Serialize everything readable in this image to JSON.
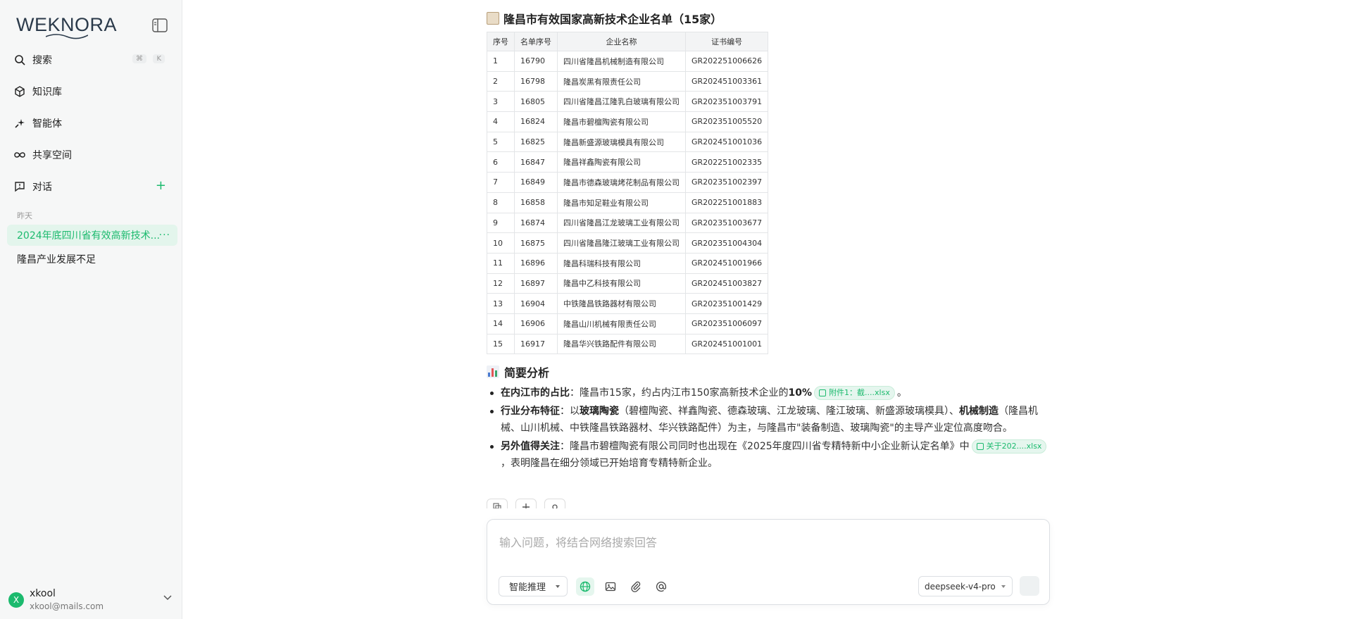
{
  "sidebar": {
    "logo": "WEKNORA",
    "nav": [
      {
        "label": "搜索",
        "icon": "search-icon",
        "shortcut": [
          "⌘",
          "K"
        ]
      },
      {
        "label": "知识库",
        "icon": "cube-icon"
      },
      {
        "label": "智能体",
        "icon": "sparkle-icon"
      },
      {
        "label": "共享空间",
        "icon": "infinity-icon"
      },
      {
        "label": "对话",
        "icon": "chat-icon",
        "add": "+"
      }
    ],
    "section_label": "昨天",
    "conversations": [
      {
        "label": "2024年底四川省有效高新技术...",
        "more": "···"
      },
      {
        "label": "隆昌产业发展不足"
      }
    ],
    "user": {
      "initial": "X",
      "name": "xkool",
      "email": "xkool@mails.com"
    }
  },
  "message": {
    "title": "隆昌市有效国家高新技术企业名单（15家）",
    "table": {
      "headers": [
        "序号",
        "名单序号",
        "企业名称",
        "证书编号"
      ],
      "rows": [
        [
          "1",
          "16790",
          "四川省隆昌机械制造有限公司",
          "GR202251006626"
        ],
        [
          "2",
          "16798",
          "隆昌炭黑有限责任公司",
          "GR202451003361"
        ],
        [
          "3",
          "16805",
          "四川省隆昌江隆乳白玻璃有限公司",
          "GR202351003791"
        ],
        [
          "4",
          "16824",
          "隆昌市碧檀陶瓷有限公司",
          "GR202351005520"
        ],
        [
          "5",
          "16825",
          "隆昌新盛源玻璃模具有限公司",
          "GR202451001036"
        ],
        [
          "6",
          "16847",
          "隆昌祥鑫陶瓷有限公司",
          "GR202251002335"
        ],
        [
          "7",
          "16849",
          "隆昌市德森玻璃烤花制品有限公司",
          "GR202351002397"
        ],
        [
          "8",
          "16858",
          "隆昌市知足鞋业有限公司",
          "GR202251001883"
        ],
        [
          "9",
          "16874",
          "四川省隆昌江龙玻璃工业有限公司",
          "GR202351003677"
        ],
        [
          "10",
          "16875",
          "四川省隆昌隆江玻璃工业有限公司",
          "GR202351004304"
        ],
        [
          "11",
          "16896",
          "隆昌科瑞科技有限公司",
          "GR202451001966"
        ],
        [
          "12",
          "16897",
          "隆昌中乙科技有限公司",
          "GR202451003827"
        ],
        [
          "13",
          "16904",
          "中铁隆昌铁路器材有限公司",
          "GR202351001429"
        ],
        [
          "14",
          "16906",
          "隆昌山川机械有限责任公司",
          "GR202351006097"
        ],
        [
          "15",
          "16917",
          "隆昌华兴铁路配件有限公司",
          "GR202451001001"
        ]
      ]
    },
    "analysis_title": "简要分析",
    "bullets": {
      "b1": {
        "bold": "在内江市的占比",
        "text": "：隆昌市15家，约占内江市150家高新技术企业的",
        "pct": "10%",
        "chip": "附件1：截....xlsx",
        "end": "。"
      },
      "b2": {
        "bold": "行业分布特征",
        "t1": "：以",
        "bold2": "玻璃陶瓷",
        "t2": "（碧檀陶瓷、祥鑫陶瓷、德森玻璃、江龙玻璃、隆江玻璃、新盛源玻璃模具）、",
        "bold3": "机械制造",
        "t3": "（隆昌机械、山川机械、中铁隆昌铁路器材、华兴铁路配件）为主，与隆昌市\"装备制造、玻璃陶瓷\"的主导产业定位高度吻合。"
      },
      "b3": {
        "bold": "另外值得关注",
        "text": "：隆昌市碧檀陶瓷有限公司同时也出现在《2025年度四川省专精特新中小企业新认定名单》中",
        "chip": "关于202....xlsx",
        "end": "，表明隆昌在细分领域已开始培育专精特新企业。"
      }
    }
  },
  "input": {
    "placeholder": "输入问题，将结合网络搜索回答",
    "mode": "智能推理",
    "model": "deepseek-v4-pro"
  },
  "colors": {
    "accent": "#1cba6e",
    "sidebar_bg": "#f6f7f7"
  }
}
